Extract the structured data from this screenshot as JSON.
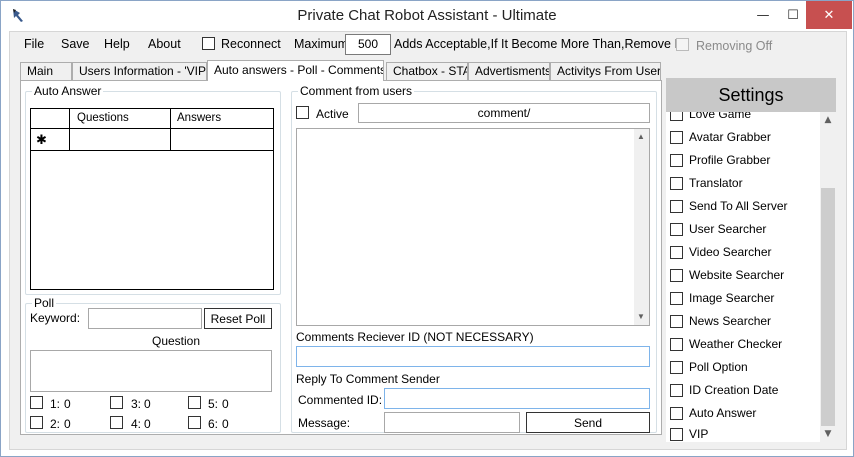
{
  "window": {
    "title": "Private Chat Robot Assistant - Ultimate",
    "minimize": "—",
    "maximize": "☐",
    "close": "✕"
  },
  "menu": {
    "file": "File",
    "save": "Save",
    "help": "Help",
    "about": "About",
    "reconnect": "Reconnect",
    "maximum_label": "Maximum",
    "maximum_value": "500",
    "adds_text": "Adds Acceptable,If It Become More Than,Remove It.",
    "removing_off": "Removing Off"
  },
  "tabs": [
    {
      "label": "Main"
    },
    {
      "label": "Users Information - 'VIP'"
    },
    {
      "label": "Auto answers - Poll - Comments"
    },
    {
      "label": "Chatbox - STA"
    },
    {
      "label": "Advertisments"
    },
    {
      "label": "Activitys From Users"
    }
  ],
  "auto_answer": {
    "group_label": "Auto Answer",
    "col_questions": "Questions",
    "col_answers": "Answers",
    "new_row_marker": "✱"
  },
  "poll": {
    "group_label": "Poll",
    "keyword_label": "Keyword:",
    "keyword_value": "",
    "reset_button": "Reset Poll",
    "question_label": "Question",
    "options": [
      {
        "label": "1:",
        "count": "0"
      },
      {
        "label": "3:",
        "count": "0"
      },
      {
        "label": "5:",
        "count": "0"
      },
      {
        "label": "2:",
        "count": "0"
      },
      {
        "label": "4:",
        "count": "0"
      },
      {
        "label": "6:",
        "count": "0"
      }
    ]
  },
  "comments": {
    "group_label": "Comment from users",
    "active_label": "Active",
    "command_value": "comment/",
    "receiver_label": "Comments Reciever ID (NOT NECESSARY)",
    "reply_label": "Reply To Comment Sender",
    "commented_id_label": "Commented ID:",
    "message_label": "Message:",
    "send_button": "Send"
  },
  "settings": {
    "header": "Settings",
    "items": [
      "Love Game",
      "Avatar Grabber",
      "Profile Grabber",
      "Translator",
      "Send To All Server",
      "User Searcher",
      "Video Searcher",
      "Website Searcher",
      "Image Searcher",
      "News Searcher",
      "Weather Checker",
      "Poll Option",
      "ID Creation Date",
      "Auto Answer",
      "VIP"
    ]
  }
}
